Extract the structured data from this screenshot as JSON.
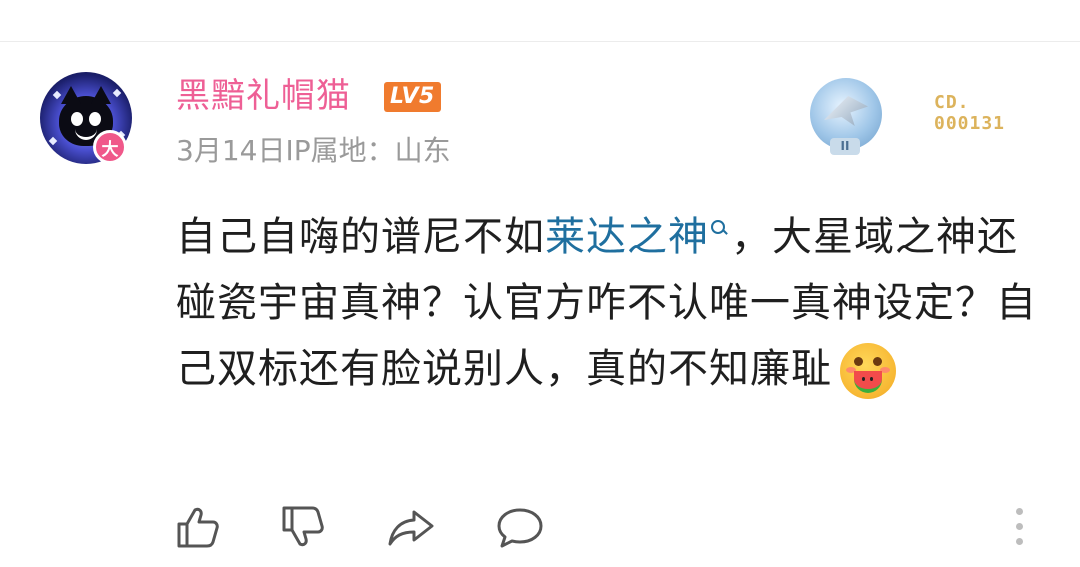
{
  "comment": {
    "username": "黑黯礼帽猫",
    "level": "LV5",
    "vip_badge": "大",
    "date": "3月14日",
    "ip_location": "IP属地：山东",
    "medal_plate": "II",
    "fan_id_line1": "CD.",
    "fan_id_line2": "000131",
    "text_part1": "自己自嗨的谱尼不如",
    "topic_link": "莱达之神",
    "text_part2": "，大星域之神还碰瓷宇宙真神？认官方咋不认唯一真神设定？自己双标还有脸说别人，真的不知廉耻"
  },
  "colors": {
    "username": "#ee5f95",
    "level_badge": "#f07b2e",
    "topic_link": "#1f6f9f",
    "meta": "#9a9a9a",
    "fan_id": "#dcb35c"
  },
  "icons": [
    "like-icon",
    "dislike-icon",
    "share-icon",
    "reply-icon",
    "more-icon",
    "search-icon",
    "watermelon-emoji"
  ]
}
